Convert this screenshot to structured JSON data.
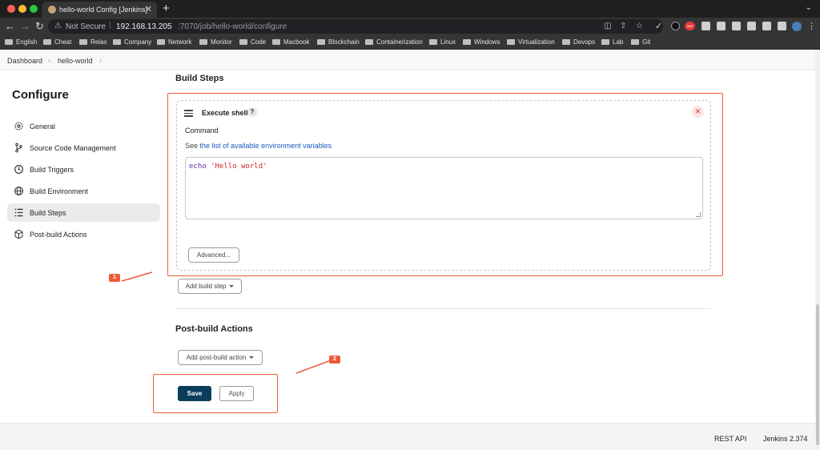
{
  "browser": {
    "tab_title": "hello-world Config [Jenkins]",
    "tab_close": "✕",
    "new_tab": "+",
    "address": {
      "not_secure": "Not Secure",
      "host": "192.168.13.205",
      "path": ":7070/job/hello-world/configure"
    },
    "bookmarks": [
      "English",
      "Cheat",
      "Relax",
      "Company",
      "Network",
      "Monitor",
      "Code",
      "Macbook",
      "Blockchain",
      "Containerization",
      "Linux",
      "Windows",
      "Virtualization",
      "Devops",
      "Lab",
      "Git"
    ],
    "extension_badge": "ABP"
  },
  "breadcrumb": [
    "Dashboard",
    "hello-world"
  ],
  "sidebar": {
    "title": "Configure",
    "items": [
      {
        "label": "General",
        "icon": "gear-icon"
      },
      {
        "label": "Source Code Management",
        "icon": "branch-icon"
      },
      {
        "label": "Build Triggers",
        "icon": "clock-icon"
      },
      {
        "label": "Build Environment",
        "icon": "globe-icon"
      },
      {
        "label": "Build Steps",
        "icon": "list-icon",
        "active": true
      },
      {
        "label": "Post-build Actions",
        "icon": "package-icon"
      }
    ]
  },
  "build_steps": {
    "heading": "Build Steps",
    "step": {
      "title": "Execute shell",
      "help": "?",
      "close": "✕",
      "command_label": "Command",
      "see_prefix": "See",
      "env_link": "the list of available environment variables",
      "command_keyword": "echo",
      "command_string": "'Hello world'",
      "advanced_label": "Advanced..."
    },
    "add_step_label": "Add build step"
  },
  "post_build": {
    "heading": "Post-build Actions",
    "add_action_label": "Add post-build action"
  },
  "actions": {
    "save_label": "Save",
    "apply_label": "Apply"
  },
  "footer": {
    "rest_api": "REST API",
    "version": "Jenkins 2.374"
  },
  "annotations": [
    "1",
    "2"
  ],
  "colors": {
    "annotation": "#ef5a3c",
    "save_button": "#0b3d5b",
    "link": "#1a5bbd"
  }
}
